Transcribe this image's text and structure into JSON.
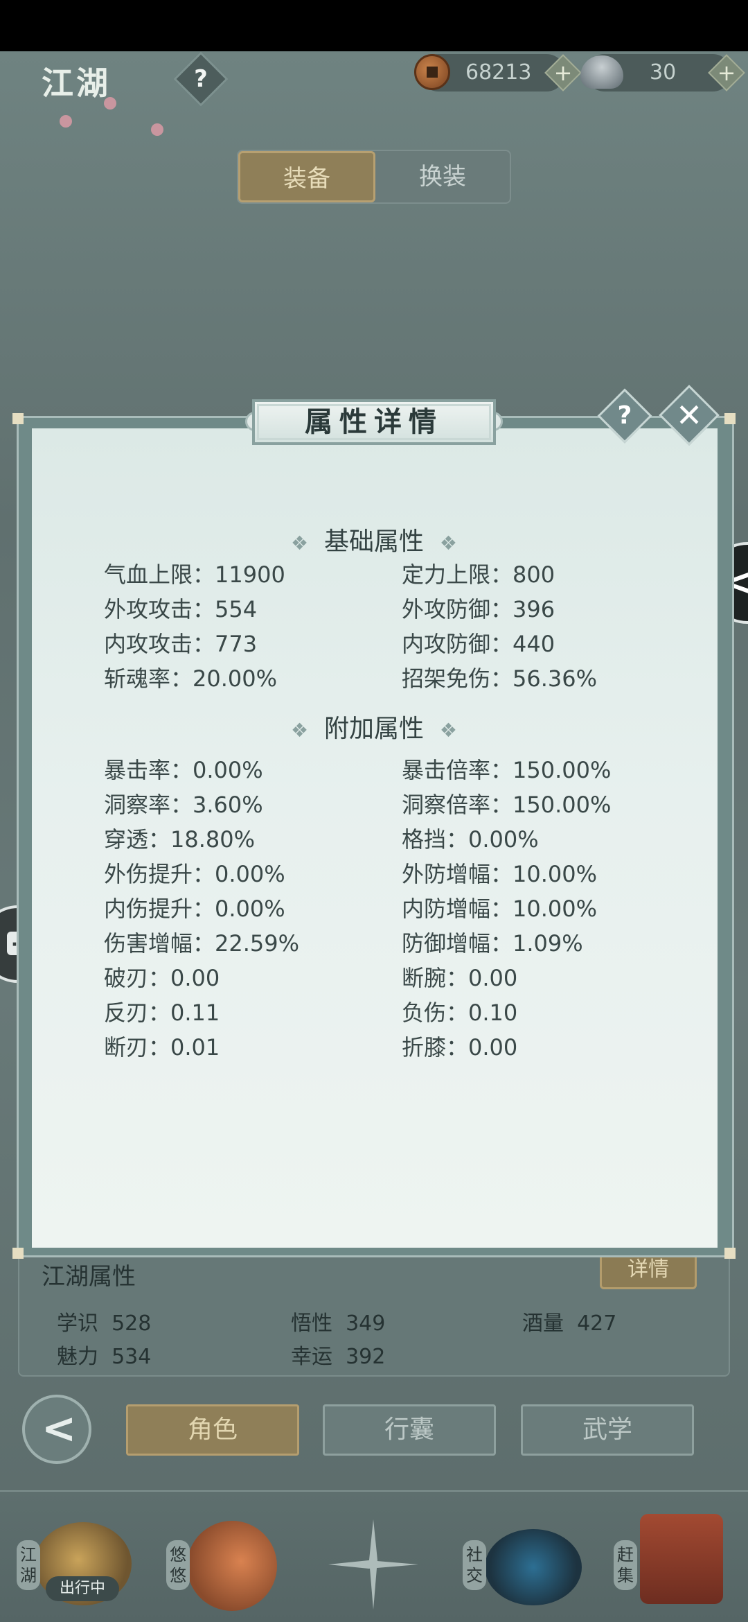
{
  "header": {
    "title": "江湖",
    "help_symbol": "?",
    "coins": "68213",
    "silver": "30",
    "plus_symbol": "+"
  },
  "segment": {
    "tab_equip": "装备",
    "tab_switch": "换装"
  },
  "side": {
    "collapse_symbol": "<",
    "chat_dots": "···"
  },
  "dialog": {
    "title": "属性详情",
    "help_symbol": "?",
    "close_symbol": "✕",
    "ornament": "❖",
    "basic_heading": "基础属性",
    "basic": [
      {
        "left": "气血上限：11900",
        "right": "定力上限：800"
      },
      {
        "left": "外攻攻击：554",
        "right": "外攻防御：396"
      },
      {
        "left": "内攻攻击：773",
        "right": "内攻防御：440"
      },
      {
        "left": "斩魂率：20.00%",
        "right": "招架免伤：56.36%"
      }
    ],
    "extra_heading": "附加属性",
    "extra": [
      {
        "left": "暴击率：0.00%",
        "right": "暴击倍率：150.00%"
      },
      {
        "left": "洞察率：3.60%",
        "right": "洞察倍率：150.00%"
      },
      {
        "left": "穿透：18.80%",
        "right": "格挡：0.00%"
      },
      {
        "left": "外伤提升：0.00%",
        "right": "外防增幅：10.00%"
      },
      {
        "left": "内伤提升：0.00%",
        "right": "内防增幅：10.00%"
      },
      {
        "left": "伤害增幅：22.59%",
        "right": "防御增幅：1.09%"
      },
      {
        "left": "破刃：0.00",
        "right": "断腕：0.00"
      },
      {
        "left": "反刃：0.11",
        "right": "负伤：0.10"
      },
      {
        "left": "断刃：0.01",
        "right": "折膝：0.00"
      }
    ]
  },
  "lower_panel": {
    "caption": "江湖属性",
    "detail_button": "详情",
    "attrs": [
      {
        "label": "学识",
        "value": "528"
      },
      {
        "label": "悟性",
        "value": "349"
      },
      {
        "label": "酒量",
        "value": "427"
      },
      {
        "label": "魅力",
        "value": "534"
      },
      {
        "label": "幸运",
        "value": "392"
      }
    ]
  },
  "bottom_tabs": {
    "back_symbol": "<",
    "role": "角色",
    "bag": "行囊",
    "martial": "武学"
  },
  "bottom_nav": {
    "jianghu": "江湖",
    "youyou": "悠悠",
    "social": "社交",
    "market": "赶集",
    "status": "出行中"
  }
}
